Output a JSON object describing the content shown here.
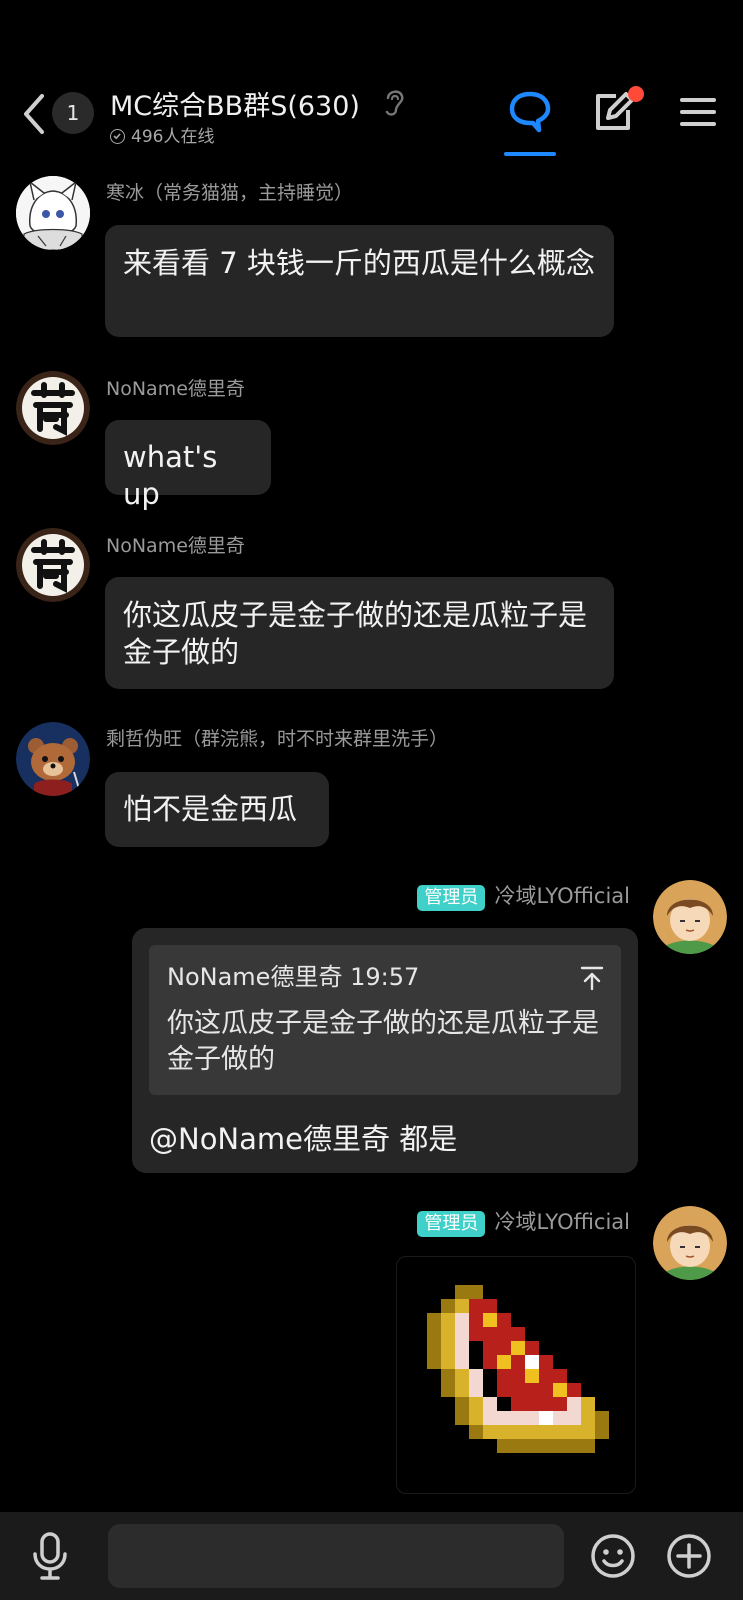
{
  "header": {
    "unread_count": "1",
    "group_title": "MC综合BB群S(630)",
    "online_text": "496人在线"
  },
  "messages": [
    {
      "sender": "寒冰（常务猫猫，主持睡觉）",
      "text": "来看看 7 块钱一斤的西瓜是什么概念"
    },
    {
      "sender": "NoName德里奇",
      "text": "what's up"
    },
    {
      "sender": "NoName德里奇",
      "text": "你这瓜皮子是金子做的还是瓜粒子是金子做的"
    },
    {
      "sender": "剩哲伪旺（群浣熊，时不时来群里洗手）",
      "text": "怕不是金西瓜"
    },
    {
      "sender": "冷域LYOfficial",
      "role_tag": "管理员",
      "quote_author": "NoName德里奇 19:57",
      "quote_text": "你这瓜皮子是金子做的还是瓜粒子是金子做的",
      "text": "@NoName德里奇 都是"
    },
    {
      "sender": "冷域LYOfficial",
      "role_tag": "管理员",
      "image": "golden-melon-slice-pixel-art"
    }
  ],
  "icons": [
    "back-arrow-icon",
    "ear-icon",
    "chat-bubble-icon",
    "edit-icon",
    "menu-icon",
    "microphone-icon",
    "emoji-icon",
    "plus-icon"
  ],
  "colors": {
    "accent": "#1e88ff",
    "notification": "#ff4a3a",
    "admin_tag": "#3fd0c9",
    "bubble": "#262626"
  }
}
